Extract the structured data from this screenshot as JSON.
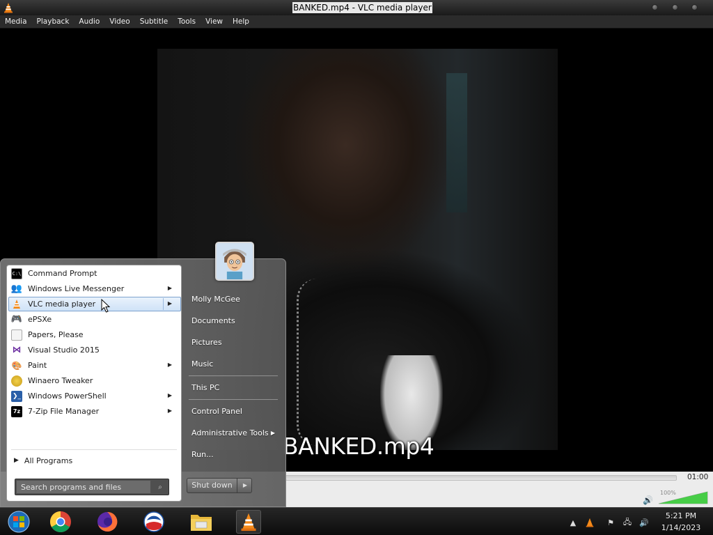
{
  "window": {
    "title": "BANKED.mp4 - VLC media player"
  },
  "menubar": [
    "Media",
    "Playback",
    "Audio",
    "Video",
    "Subtitle",
    "Tools",
    "View",
    "Help"
  ],
  "video": {
    "osd_title": "BANKED.mp4"
  },
  "controls": {
    "time_total": "01:00",
    "volume_label": "100%",
    "volume_level": 1.0
  },
  "start_menu": {
    "programs": [
      {
        "label": "Command Prompt",
        "icon": "command-prompt-icon",
        "submenu": false
      },
      {
        "label": "Windows Live Messenger",
        "icon": "messenger-icon",
        "submenu": true
      },
      {
        "label": "VLC media player",
        "icon": "vlc-cone-icon",
        "submenu": true,
        "selected": true
      },
      {
        "label": "ePSXe",
        "icon": "gamepad-icon",
        "submenu": false
      },
      {
        "label": "Papers, Please",
        "icon": "document-icon",
        "submenu": false
      },
      {
        "label": "Visual Studio 2015",
        "icon": "visual-studio-icon",
        "submenu": false
      },
      {
        "label": "Paint",
        "icon": "paint-palette-icon",
        "submenu": true
      },
      {
        "label": "Winaero Tweaker",
        "icon": "winaero-icon",
        "submenu": false
      },
      {
        "label": "Windows PowerShell",
        "icon": "powershell-icon",
        "submenu": true
      },
      {
        "label": "7-Zip File Manager",
        "icon": "7zip-icon",
        "submenu": true
      }
    ],
    "all_programs": "All Programs",
    "search_placeholder": "Search programs and files",
    "user_name": "Molly McGee",
    "links": {
      "documents": "Documents",
      "pictures": "Pictures",
      "music": "Music",
      "this_pc": "This PC",
      "control_panel": "Control Panel",
      "admin_tools": "Administrative Tools",
      "run": "Run..."
    },
    "shutdown": "Shut down"
  },
  "taskbar": {
    "apps": [
      "start-orb-icon",
      "chrome-icon",
      "firefox-icon",
      "obama-logo-icon",
      "file-explorer-icon",
      "vlc-cone-icon"
    ],
    "clock_time": "5:21 PM",
    "clock_date": "1/14/2023"
  }
}
